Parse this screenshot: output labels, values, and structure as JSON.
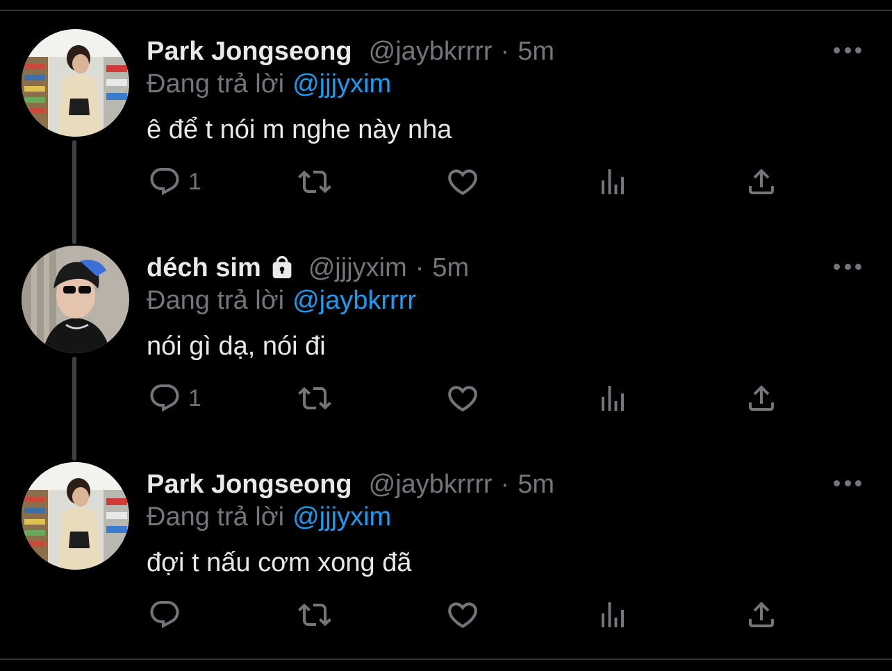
{
  "thread": [
    {
      "display_name": "Park Jongseong",
      "locked": false,
      "handle": "@jaybkrrrr",
      "separator": "·",
      "time": "5m",
      "reply_prefix": "Đang trả lời",
      "reply_to": "@jjjyxim",
      "text": "ê để t nói m nghe này nha",
      "reply_count": "1"
    },
    {
      "display_name": "déch sim",
      "locked": true,
      "handle": "@jjjyxim",
      "separator": "·",
      "time": "5m",
      "reply_prefix": "Đang trả lời",
      "reply_to": "@jaybkrrrr",
      "text": "nói gì dạ, nói đi",
      "reply_count": "1"
    },
    {
      "display_name": "Park Jongseong",
      "locked": false,
      "handle": "@jaybkrrrr",
      "separator": "·",
      "time": "5m",
      "reply_prefix": "Đang trả lời",
      "reply_to": "@jjjyxim",
      "text": "đợi t nấu cơm xong đã",
      "reply_count": ""
    }
  ],
  "icons": {
    "reply": "reply-icon",
    "retweet": "retweet-icon",
    "like": "heart-icon",
    "views": "analytics-icon",
    "share": "share-icon",
    "more": "more-options-icon",
    "lock": "lock-icon"
  },
  "colors": {
    "background": "#000000",
    "text_primary": "#e7e9ea",
    "text_secondary": "#71767b",
    "accent": "#1d9bf0",
    "thread_line": "#3e4144"
  }
}
